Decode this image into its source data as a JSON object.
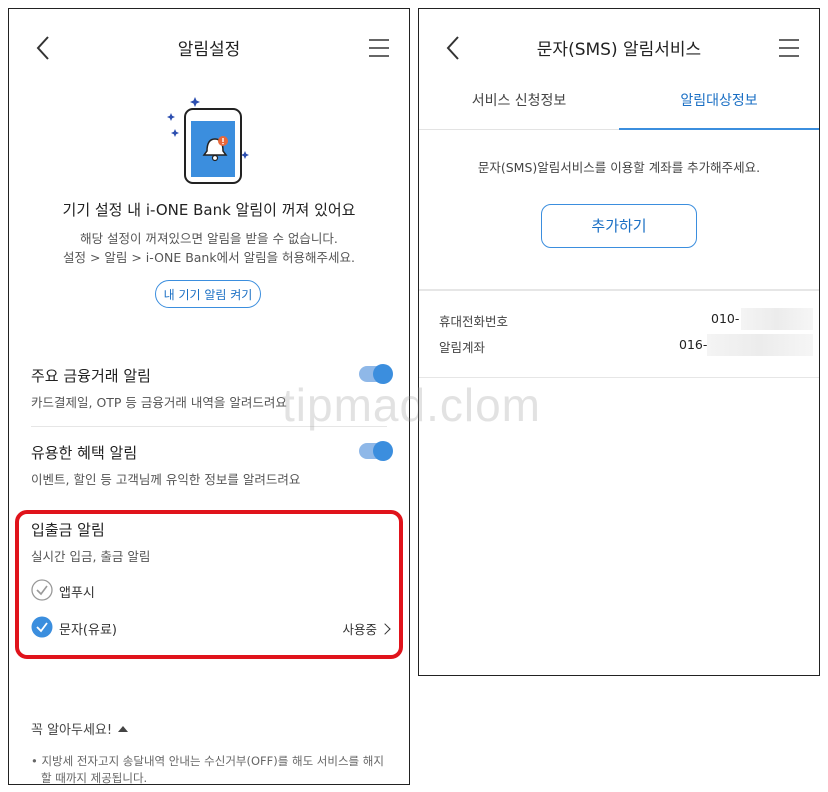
{
  "watermark": "tipmad.clom",
  "left": {
    "header": {
      "title": "알림설정"
    },
    "notice": {
      "heading": "기기 설정 내 i-ONE Bank 알림이 꺼져 있어요",
      "line1": "해당 설정이 꺼져있으면 알림을 받을 수 없습니다.",
      "line2": "설정 > 알림 > i-ONE Bank에서 알림을 허용해주세요.",
      "button": "내 기기 알림 켜기"
    },
    "settings": [
      {
        "title": "주요 금융거래 알림",
        "desc": "카드결제일, OTP 등 금융거래 내역을 알려드려요",
        "enabled": true
      },
      {
        "title": "유용한 혜택 알림",
        "desc": "이벤트, 할인 등 고객님께 유익한 정보를 알려드려요",
        "enabled": true
      }
    ],
    "deposit": {
      "title": "입출금 알림",
      "desc": "실시간 입금, 출금 알림",
      "options": [
        {
          "label": "앱푸시",
          "checked": false
        },
        {
          "label": "문자(유료)",
          "checked": true
        }
      ],
      "status": "사용중"
    },
    "footer": {
      "title": "꼭 알아두세요!",
      "line1": "• 지방세 전자고지 송달내역 안내는 수신거부(OFF)를 해도 서비스를 해지",
      "line2": "할 때까지 제공됩니다."
    }
  },
  "right": {
    "header": {
      "title": "문자(SMS) 알림서비스"
    },
    "tabs": [
      {
        "label": "서비스 신청정보",
        "active": false
      },
      {
        "label": "알림대상정보",
        "active": true
      }
    ],
    "message": "문자(SMS)알림서비스를 이용할 계좌를 추가해주세요.",
    "add_button": "추가하기",
    "info": [
      {
        "label": "휴대전화번호",
        "value": "010-"
      },
      {
        "label": "알림계좌",
        "value": "016-"
      }
    ]
  },
  "colors": {
    "accent": "#3b8ede",
    "highlight": "#e0131b"
  }
}
